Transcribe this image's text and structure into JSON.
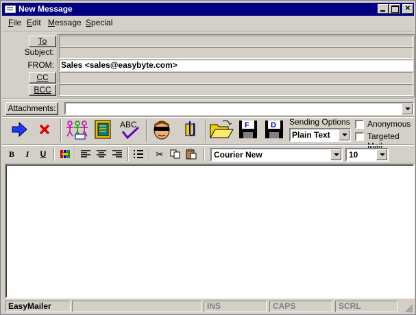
{
  "window": {
    "title": "New Message"
  },
  "menu": [
    {
      "label": "File",
      "accel": "F",
      "rest": "ile"
    },
    {
      "label": "Edit",
      "accel": "E",
      "rest": "dit"
    },
    {
      "label": "Message",
      "accel": "M",
      "rest": "essage"
    },
    {
      "label": "Special",
      "accel": "S",
      "rest": "pecial"
    }
  ],
  "header": {
    "to_button": "To",
    "subject_label": "Subject:",
    "from_label": "FROM:",
    "cc_button": "CC",
    "bcc_button": "BCC",
    "to_value": "",
    "subject_value": "",
    "from_value": "Sales <sales@easybyte.com>",
    "cc_value": "",
    "bcc_value": ""
  },
  "attachments": {
    "button": "Attachments:",
    "value": ""
  },
  "toolbar": {
    "sending_options_label": "Sending Options",
    "sending_format": "Plain Text",
    "anonymous_label": "Anonymous",
    "targeted_mail_label": "Targeted Mail",
    "abc_text": "ABC",
    "save_f": "F",
    "save_d": "D"
  },
  "format": {
    "bold": "B",
    "italic": "I",
    "underline": "U",
    "font": "Courier New",
    "size": "10"
  },
  "message_body": "",
  "status": {
    "app": "EasyMailer",
    "ins": "INS",
    "caps": "CAPS",
    "scrl": "SCRL"
  },
  "colors": {
    "titlebar": "#000080",
    "face": "#d4d0c8",
    "send_arrow": "#1a3cff",
    "delete_x": "#e00000"
  }
}
